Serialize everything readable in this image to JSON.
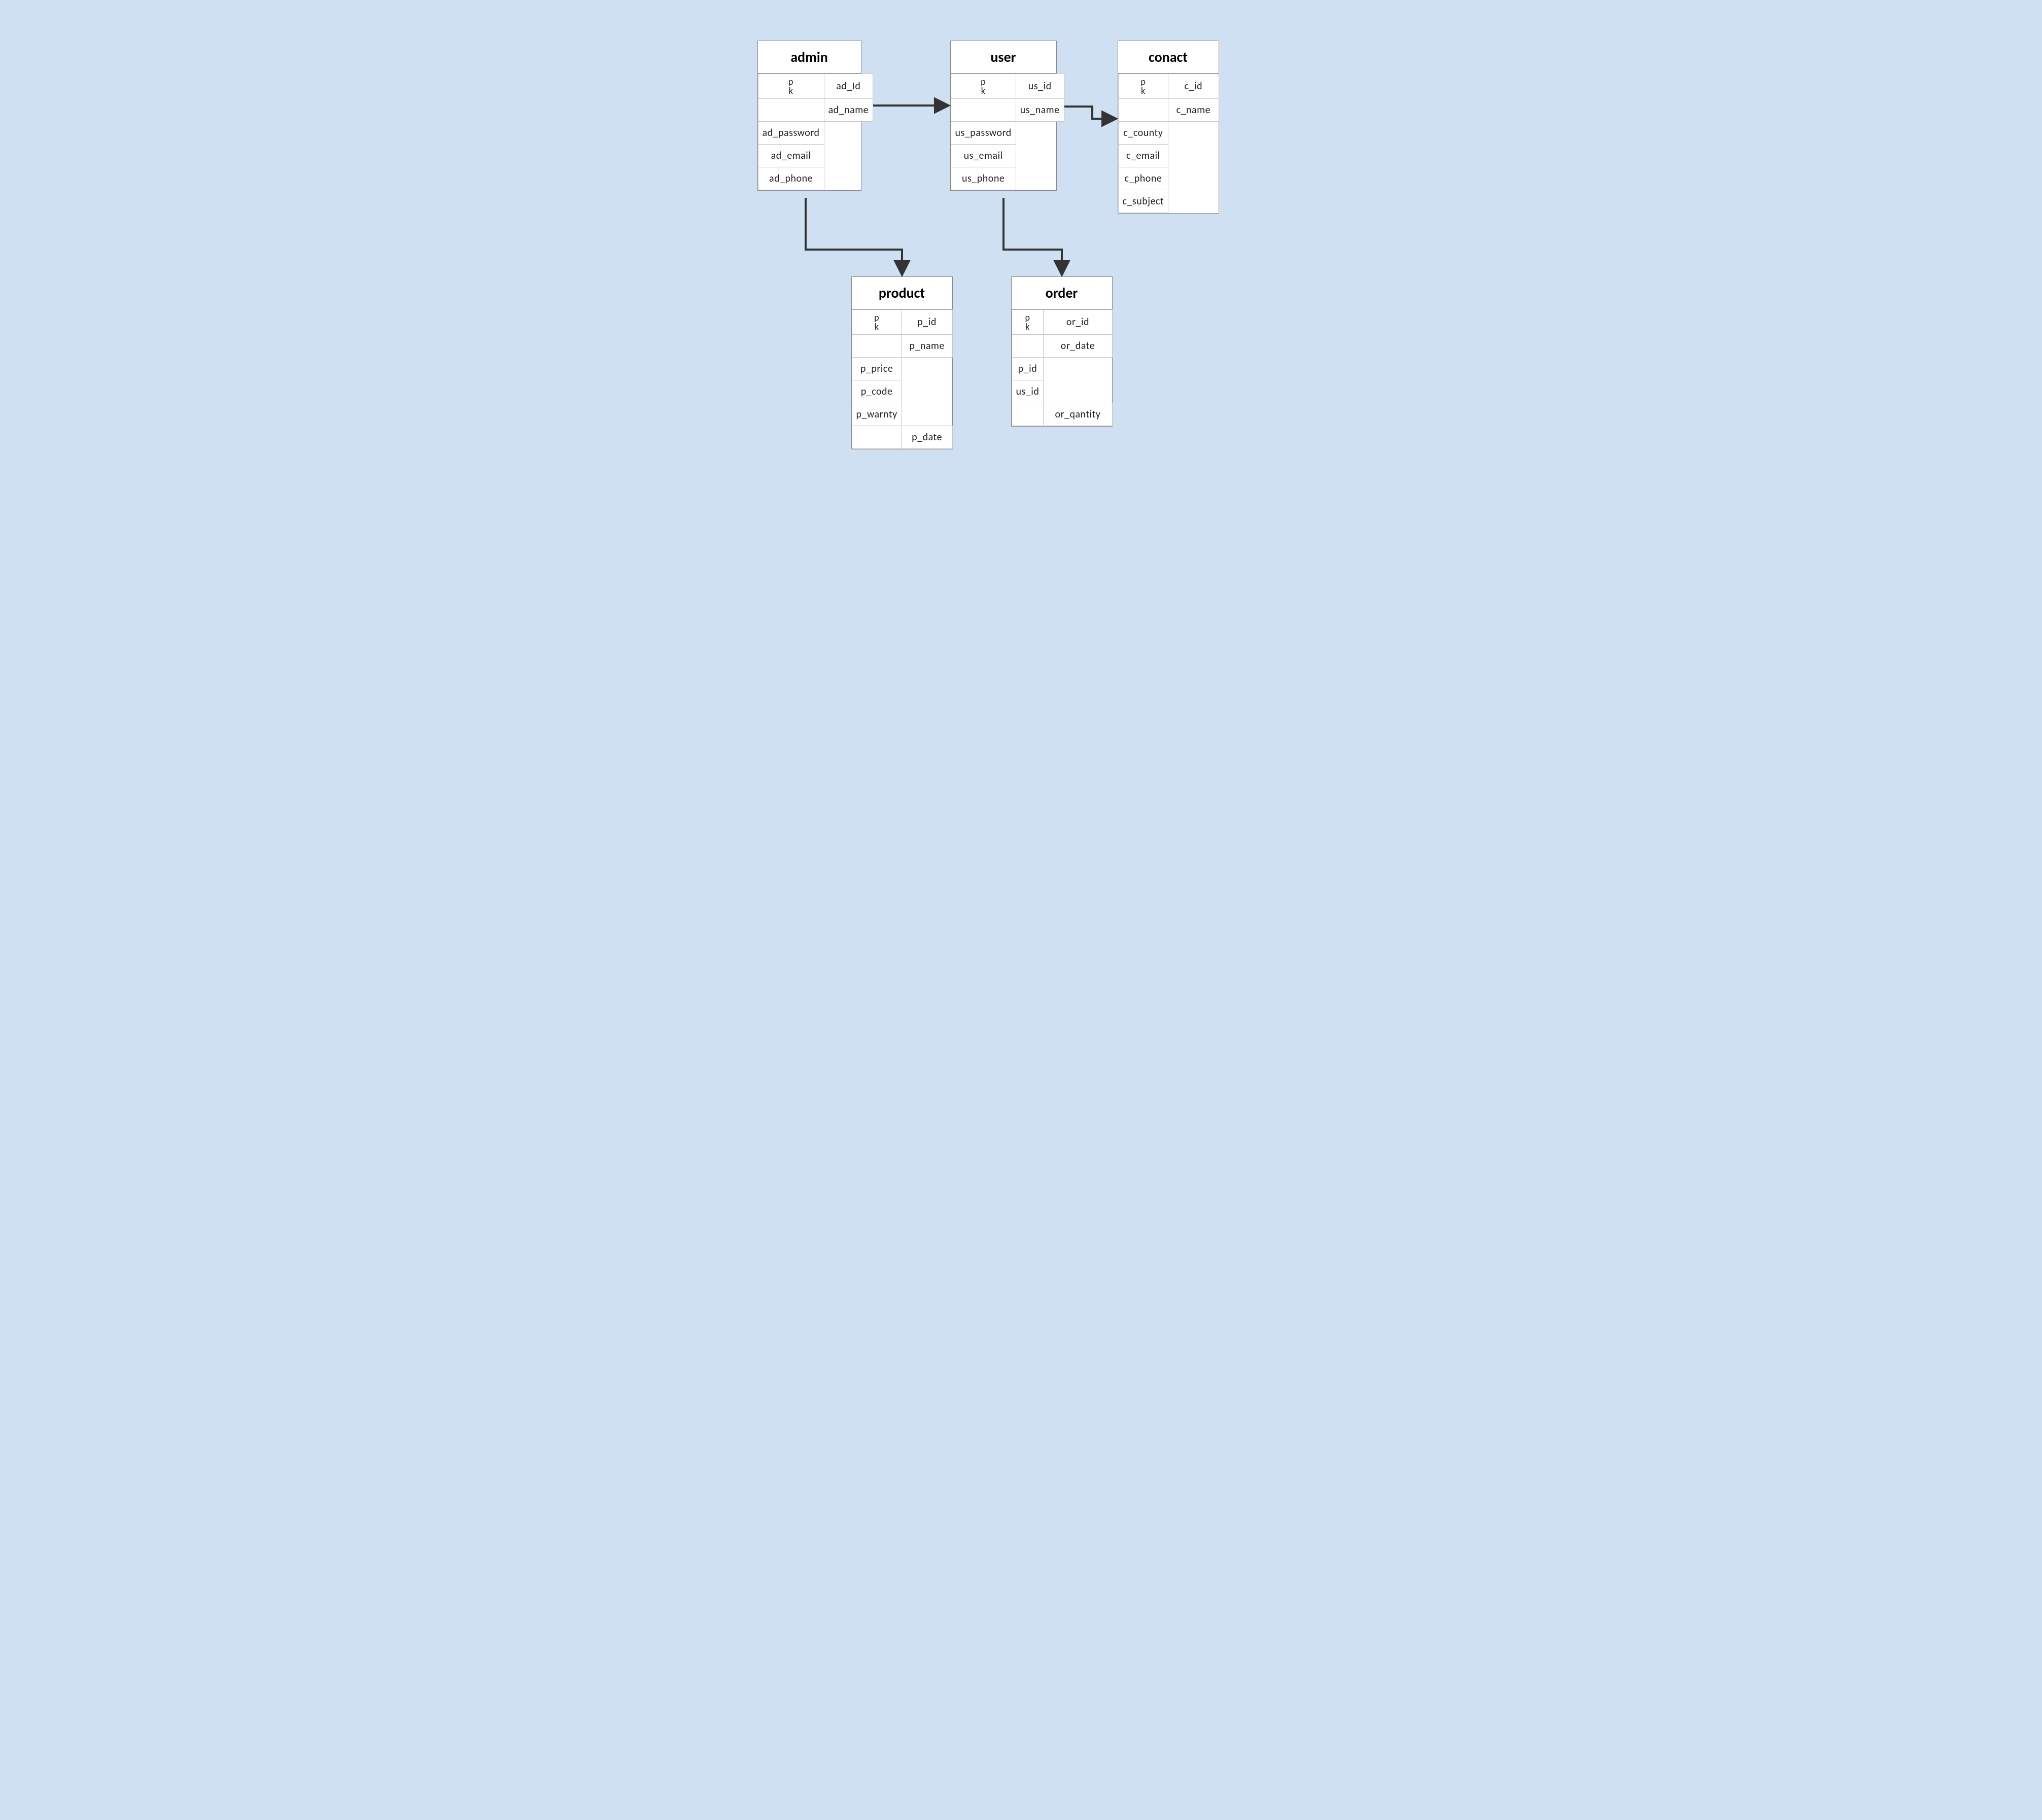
{
  "diagram": {
    "pk_label": "pk",
    "entities": {
      "admin": {
        "title": "admin",
        "fields": [
          "ad_Id",
          "ad_name",
          "ad_password",
          "ad_email",
          "ad_phone"
        ]
      },
      "user": {
        "title": "user",
        "fields": [
          "us_id",
          "us_name",
          "us_password",
          "us_email",
          "us_phone"
        ]
      },
      "conact": {
        "title": "conact",
        "fields": [
          "c_id",
          "c_name",
          "c_county",
          "c_email",
          "c_phone",
          "c_subject"
        ]
      },
      "product": {
        "title": "product",
        "fields": [
          "p_id",
          "p_name",
          "p_price",
          "p_code",
          "p_warnty",
          "p_date"
        ]
      },
      "order": {
        "title": "order",
        "fields": [
          "or_id",
          "or_date",
          "p_id",
          "us_id",
          "or_qantity"
        ]
      }
    },
    "relations": [
      {
        "from": "admin",
        "to": "user",
        "name": "admin-to-user"
      },
      {
        "from": "user",
        "to": "conact",
        "name": "user-to-conact"
      },
      {
        "from": "admin",
        "to": "product",
        "name": "admin-to-product"
      },
      {
        "from": "user",
        "to": "order",
        "name": "user-to-order"
      }
    ]
  }
}
